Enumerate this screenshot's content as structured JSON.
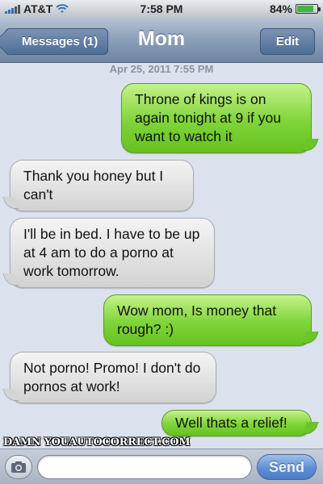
{
  "status_bar": {
    "carrier": "AT&T",
    "time": "7:58 PM",
    "battery_text": "84%",
    "battery_level": 0.84,
    "signal_icon": "signal-bars-icon",
    "wifi_icon": "wifi-icon",
    "battery_icon": "battery-icon"
  },
  "nav": {
    "back_label": "Messages (1)",
    "title": "Mom",
    "edit_label": "Edit"
  },
  "conversation": {
    "timestamp": "Apr 25, 2011 7:55 PM",
    "messages": [
      {
        "direction": "sent",
        "text": "Throne of kings is on again tonight at 9 if you want to watch it"
      },
      {
        "direction": "received",
        "text": "Thank you honey but I can't"
      },
      {
        "direction": "received",
        "text": "I'll be in bed. I have to be up at 4 am to do a porno at work tomorrow."
      },
      {
        "direction": "sent",
        "text": "Wow mom, Is money that rough? :)"
      },
      {
        "direction": "received",
        "text": "Not porno! Promo! I don't do pornos at work!"
      },
      {
        "direction": "sent",
        "text": "Well thats a relief!"
      }
    ]
  },
  "watermark": "DAMN YOUAUTOCORRECT.COM",
  "input_bar": {
    "camera_icon": "camera-icon",
    "field_value": "",
    "send_label": "Send"
  },
  "colors": {
    "sent_bubble": "#7fd439",
    "received_bubble": "#e0e0e0",
    "nav_bar": "#8b9fb8",
    "background": "#dbe2ed",
    "send_button": "#5f8fd3"
  }
}
